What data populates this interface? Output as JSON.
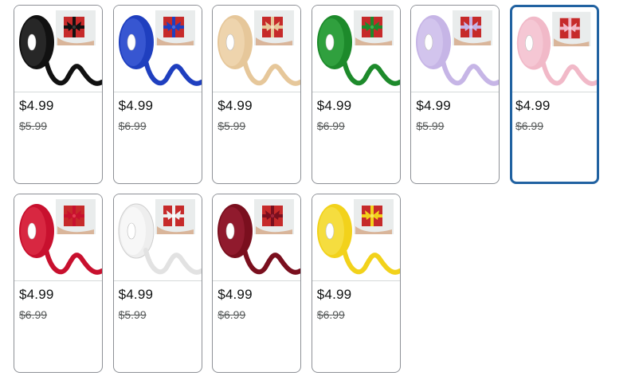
{
  "swatches": [
    {
      "color_name": "black",
      "ribbon_color": "#111111",
      "ribbon_light": "#3a3a3a",
      "price": "$4.99",
      "list_price": "$5.99",
      "selected": false
    },
    {
      "color_name": "royal-blue",
      "ribbon_color": "#1f3fbf",
      "ribbon_light": "#4a6ae0",
      "price": "$4.99",
      "list_price": "$6.99",
      "selected": false
    },
    {
      "color_name": "beige",
      "ribbon_color": "#e6c79a",
      "ribbon_light": "#f4dfbd",
      "price": "$4.99",
      "list_price": "$5.99",
      "selected": false
    },
    {
      "color_name": "green",
      "ribbon_color": "#1d8a2b",
      "ribbon_light": "#3fb34f",
      "price": "$4.99",
      "list_price": "$6.99",
      "selected": false
    },
    {
      "color_name": "lavender",
      "ribbon_color": "#c6b5e6",
      "ribbon_light": "#ddd0f2",
      "price": "$4.99",
      "list_price": "$5.99",
      "selected": false
    },
    {
      "color_name": "pink",
      "ribbon_color": "#f1b9c8",
      "ribbon_light": "#f8d4de",
      "price": "$4.99",
      "list_price": "$6.99",
      "selected": true
    },
    {
      "color_name": "red",
      "ribbon_color": "#c8102e",
      "ribbon_light": "#e53a52",
      "price": "$4.99",
      "list_price": "$6.99",
      "selected": false
    },
    {
      "color_name": "white",
      "ribbon_color": "#eeeeee",
      "ribbon_light": "#ffffff",
      "price": "$4.99",
      "list_price": "$5.99",
      "selected": false
    },
    {
      "color_name": "burgundy",
      "ribbon_color": "#7a0f1e",
      "ribbon_light": "#a3243a",
      "price": "$4.99",
      "list_price": "$6.99",
      "selected": false
    },
    {
      "color_name": "yellow",
      "ribbon_color": "#f2d21b",
      "ribbon_light": "#f8e55c",
      "price": "$4.99",
      "list_price": "$6.99",
      "selected": false
    }
  ],
  "colors": {
    "selected_border": "#2162a1",
    "card_border": "#8d9096",
    "price_text": "#0f1111",
    "list_price_text": "#565959",
    "gift_box": "#c62a2a"
  }
}
